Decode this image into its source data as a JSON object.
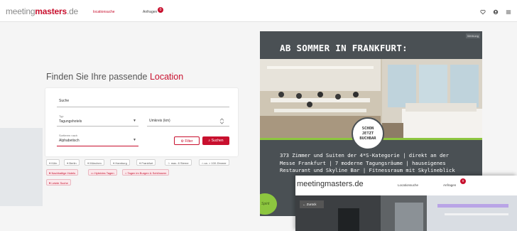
{
  "header": {
    "logo": {
      "part1": "meeting",
      "part2": "masters",
      "part3": ".de"
    },
    "nav": [
      {
        "label": "locationsuche",
        "active": true
      },
      {
        "label": "Anfragen",
        "active": false
      }
    ],
    "anfragen_badge": "0",
    "icons": [
      "heart-icon",
      "user-icon",
      "menu-icon"
    ]
  },
  "hero": {
    "headline_part1": "Finden Sie Ihre passende",
    "headline_highlight": "Location"
  },
  "search": {
    "suche_label": "Suche",
    "typ_label": "Typ",
    "typ_value": "Tagungshotels",
    "umkreis_label": "Umkreis (km)",
    "sortieren_label": "Sortieren nach",
    "sortieren_value": "Alphabetisch",
    "filter_label": "Filter",
    "suchen_label": "Suchen"
  },
  "quick_filters": [
    {
      "label": "Köln",
      "style": "grey"
    },
    {
      "label": "Berlin",
      "style": "grey"
    },
    {
      "label": "München",
      "style": "grey"
    },
    {
      "label": "Hamburg",
      "style": "grey"
    },
    {
      "label": "Frankfurt",
      "style": "grey"
    },
    {
      "label": "max. 8 Sterne",
      "style": "grey"
    },
    {
      "label": "ca. > 100 Zimmer",
      "style": "grey"
    },
    {
      "label": "Nachhaltige Hotels",
      "style": "pink"
    },
    {
      "label": "Hybrides Tagen",
      "style": "pink"
    },
    {
      "label": "Tagen im Burgen & Schlössern",
      "style": "pink"
    },
    {
      "label": "Letzte Suche",
      "style": "pink"
    }
  ],
  "ad": {
    "label": "Werbung",
    "title": "AB SOMMER IN FRANKFURT:",
    "stamp": [
      "SCHON",
      "JETZT",
      "BUCHBAR"
    ],
    "body": [
      "373 Zimmer und Suiten der 4*S-Kategorie | direkt an der",
      "Messe Frankfurt | 7 moderne Tagungsräume | hauseigenes",
      "Restaurant und Skyline Bar | Fitnessraum mit Skylineblick"
    ],
    "brand_mark": "Spirit"
  },
  "overlay": {
    "logo": {
      "part1": "meeting",
      "part2": "masters",
      "part3": ".de"
    },
    "nav": [
      "Locationsuche",
      "Anfragen"
    ],
    "badge": "0",
    "back_label": "← Zurück"
  },
  "colors": {
    "brand": "#c8102e",
    "ad_bg": "#4a5054",
    "accent_green": "#8dc63f"
  }
}
